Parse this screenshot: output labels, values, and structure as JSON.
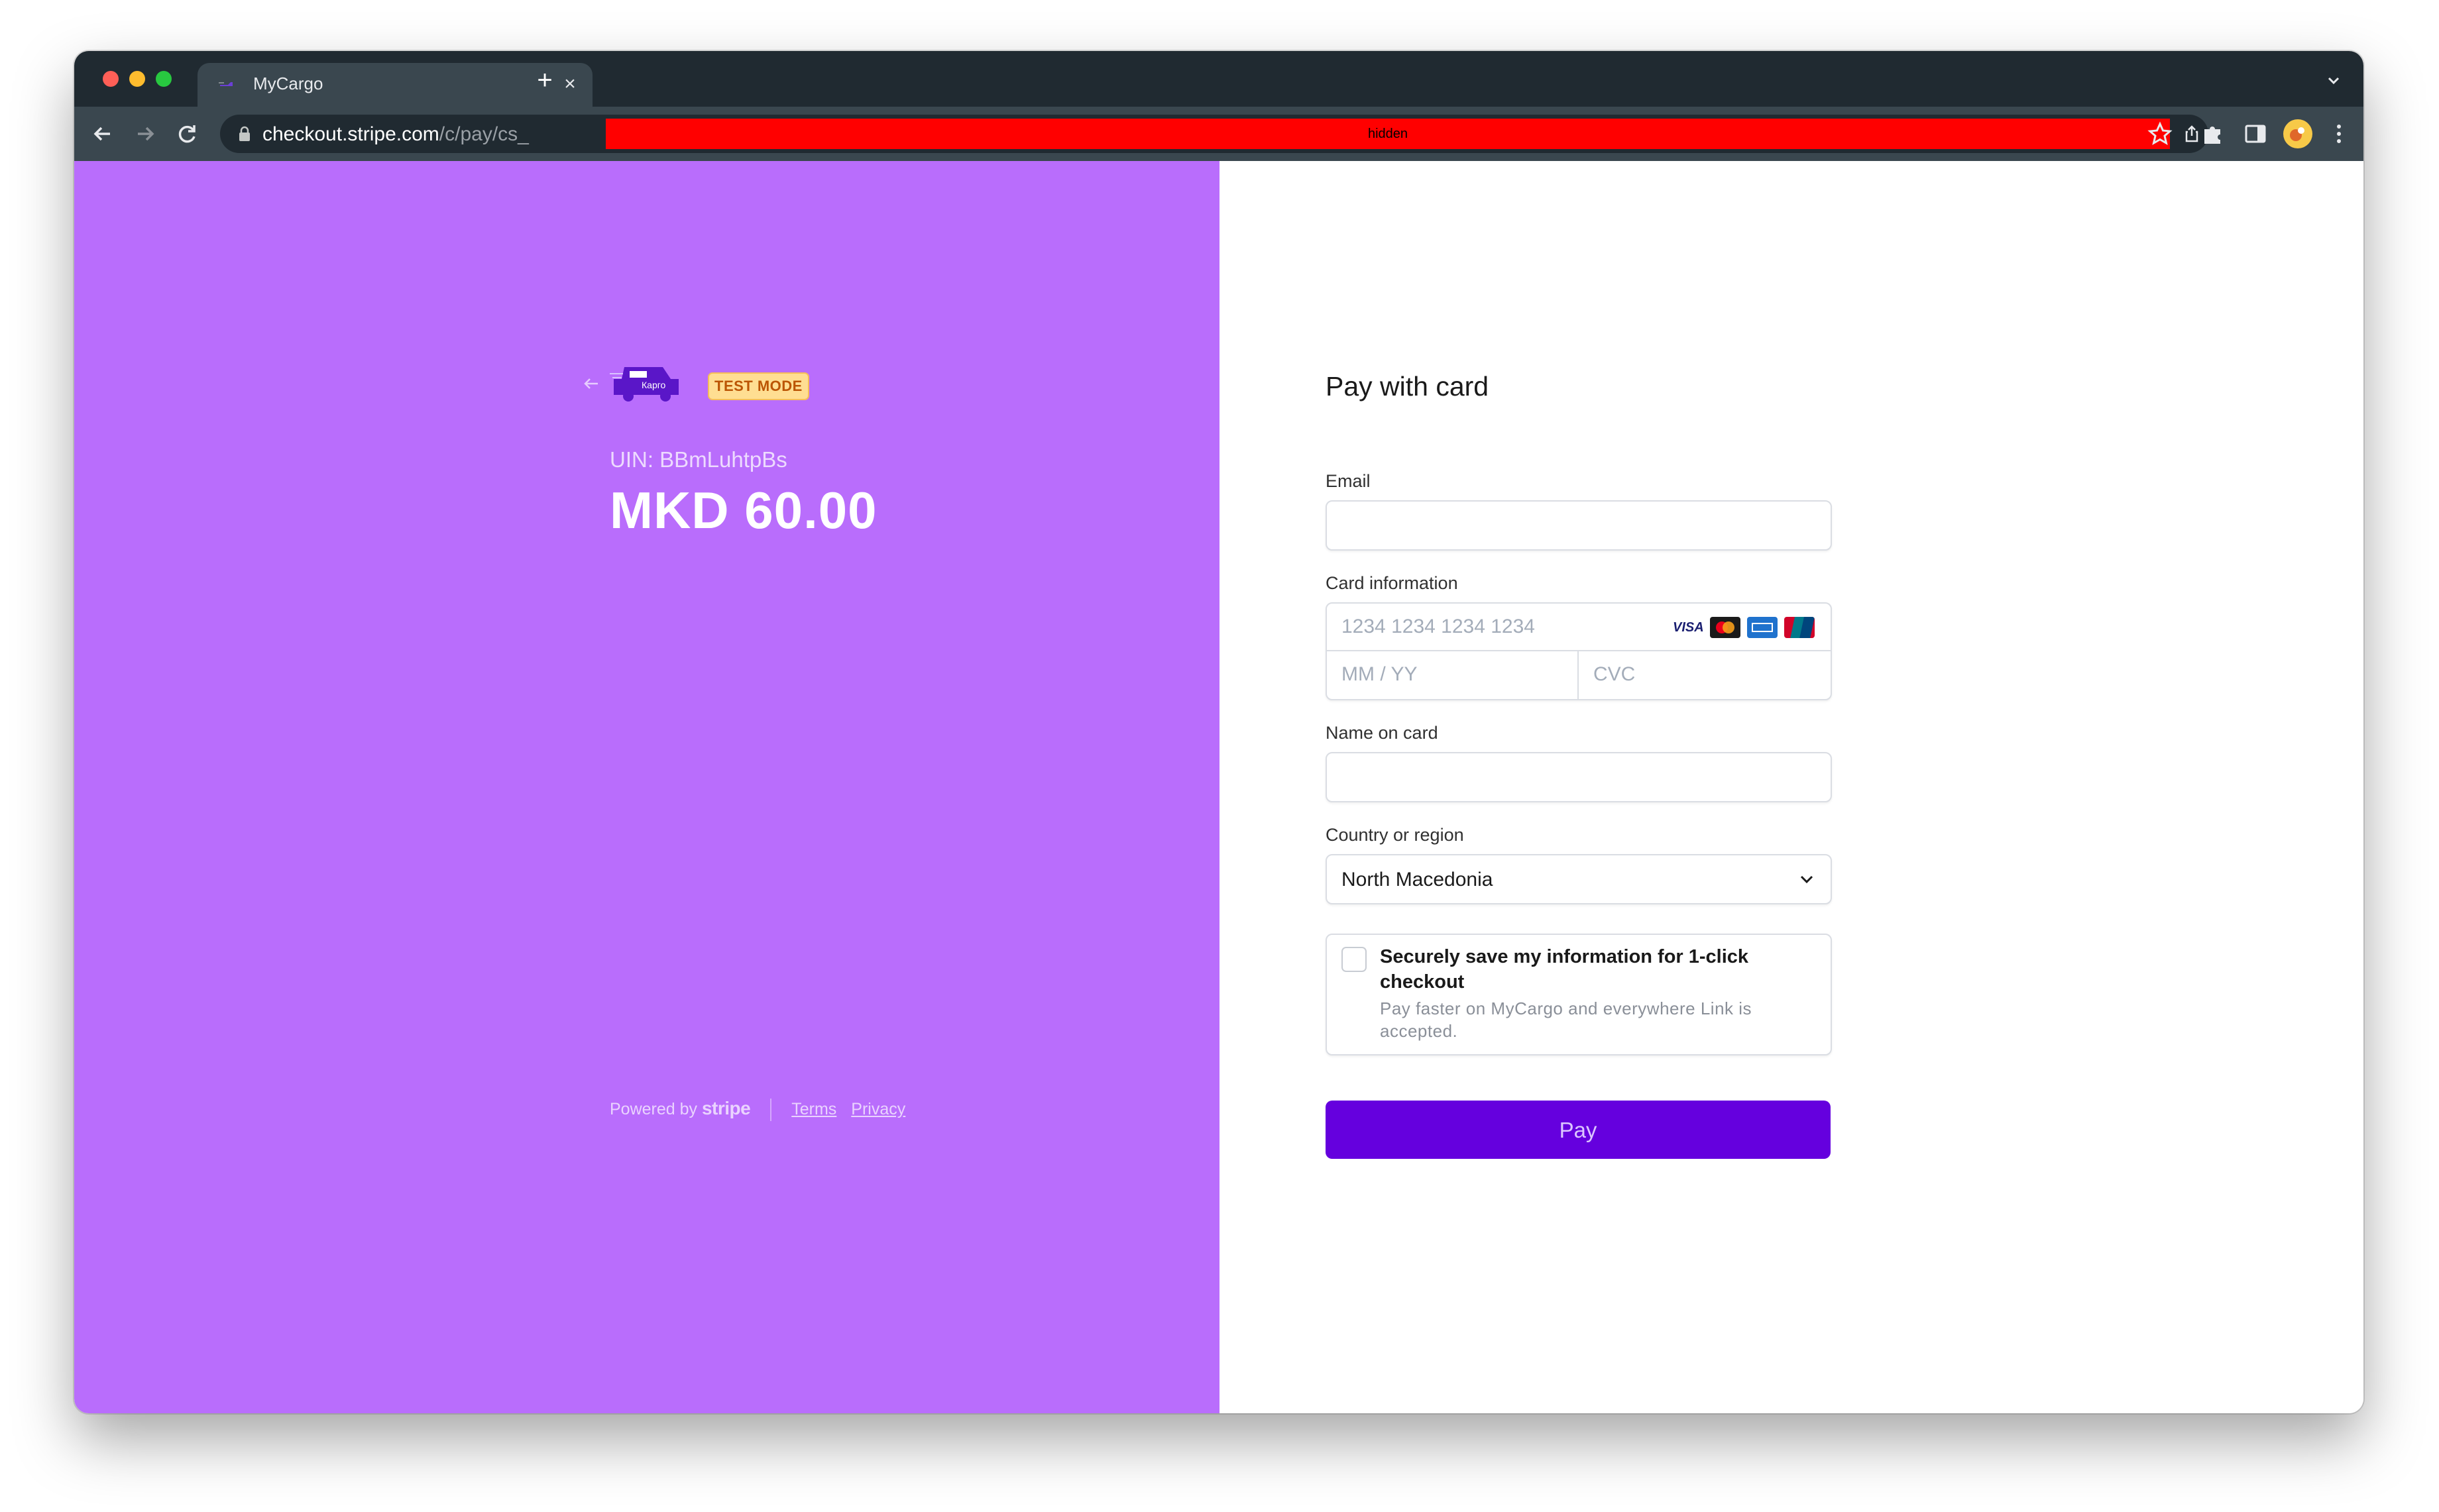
{
  "browser": {
    "tab_title": "MyCargo",
    "url_host": "checkout.stripe.com",
    "url_path": "/c/pay/cs_",
    "redacted_label": "hidden"
  },
  "merchant": {
    "logo_text": "Карго",
    "test_mode_badge": "TEST MODE",
    "uin": "UIN: BBmLuhtpBs",
    "amount": "MKD 60.00"
  },
  "footer": {
    "powered_by": "Powered by",
    "stripe": "stripe",
    "terms": "Terms",
    "privacy": "Privacy"
  },
  "form": {
    "heading": "Pay with card",
    "email_label": "Email",
    "email_value": "",
    "card_label": "Card information",
    "card_number_placeholder": "1234 1234 1234 1234",
    "expiry_placeholder": "MM / YY",
    "cvc_placeholder": "CVC",
    "card_brands": [
      "visa",
      "mastercard",
      "amex",
      "unionpay"
    ],
    "visa_text": "VISA",
    "name_label": "Name on card",
    "name_value": "",
    "country_label": "Country or region",
    "country_value": "North Macedonia",
    "save_title": "Securely save my information for 1-click checkout",
    "save_desc": "Pay faster on MyCargo and everywhere Link is accepted.",
    "save_checked": false,
    "pay_button": "Pay"
  },
  "colors": {
    "left_panel": "#b96dfc",
    "pay_button": "#6500de",
    "test_badge_bg": "#ffde92",
    "test_badge_text": "#bb5504"
  }
}
